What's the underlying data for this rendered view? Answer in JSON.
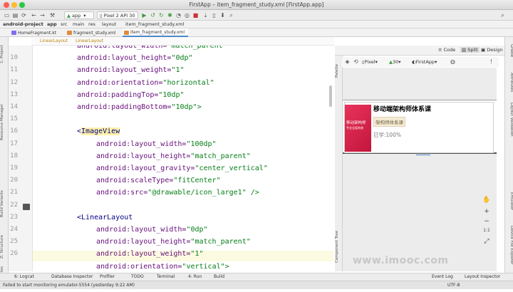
{
  "window": {
    "title": "FirstApp – item_fragment_study.xml [FirstApp.app]"
  },
  "toolbar": {
    "module": "app",
    "device": "Pixel 2 API 30"
  },
  "navbar": {
    "crumbs": [
      "android-project",
      "app",
      "src",
      "main",
      "res",
      "layout",
      "item_fragment_study.xml"
    ]
  },
  "tabs": [
    {
      "label": "HomeFragment.kt",
      "color": "#7f6df2"
    },
    {
      "label": "fragment_study.xml",
      "color": "#e08a3c"
    },
    {
      "label": "item_fragment_study.xml",
      "color": "#e08a3c",
      "active": true
    }
  ],
  "xml_crumbs": [
    "LinearLayout",
    "LinearLayout"
  ],
  "left_strip": [
    "1: Project",
    "Resource Manager",
    "Build Variants",
    "Z: Structure",
    "2: Favorites"
  ],
  "right_strip": [
    "Gradle",
    "Attributes",
    "Layout Validation",
    "Emulator",
    "Device File Explorer"
  ],
  "editor": {
    "line_numbers": [
      "10",
      "11",
      "12",
      "13",
      "14",
      "15",
      "16",
      "17",
      "18",
      "19",
      "20",
      "21",
      "22",
      "23",
      "24",
      "25",
      "26"
    ],
    "lines": [
      {
        "indent": 0,
        "attr": "android:layout_width=",
        "str": "\"match_parent\""
      },
      {
        "indent": 0,
        "attr": "android:layout_height=",
        "str": "\"0dp\"",
        "line": "10"
      },
      {
        "indent": 0,
        "attr": "android:layout_weight=",
        "str": "\"1\""
      },
      {
        "indent": 0,
        "attr": "android:orientation=",
        "str": "\"horizontal\""
      },
      {
        "indent": 0,
        "attr": "android:paddingTop=",
        "str": "\"10dp\""
      },
      {
        "indent": 0,
        "attr": "android:paddingBottom=",
        "str": "\"10dp\">"
      },
      {
        "indent": 0,
        "attr": "",
        "str": ""
      },
      {
        "indent": 0,
        "tag": "<ImageView"
      },
      {
        "indent": 1,
        "attr": "android:layout_width=",
        "str": "\"100dp\""
      },
      {
        "indent": 1,
        "attr": "android:layout_height=",
        "str": "\"match_parent\""
      },
      {
        "indent": 1,
        "attr": "android:layout_gravity=",
        "str": "\"center_vertical\""
      },
      {
        "indent": 1,
        "attr": "android:scaleType=",
        "str": "\"fitCenter\""
      },
      {
        "indent": 1,
        "attr": "android:src=",
        "str": "\"@drawable/icon_large1\" />"
      },
      {
        "indent": 0,
        "attr": "",
        "str": ""
      },
      {
        "indent": 0,
        "tag": "<LinearLayout"
      },
      {
        "indent": 1,
        "attr": "android:layout_width=",
        "str": "\"0dp\""
      },
      {
        "indent": 1,
        "attr": "android:layout_height=",
        "str": "\"match_parent\""
      },
      {
        "indent": 1,
        "attr": "android:layout_weight=",
        "str": "\"1\"",
        "highlight": true
      },
      {
        "indent": 1,
        "attr": "android:orientation=",
        "str": "\"vertical\">"
      }
    ]
  },
  "design": {
    "modes": [
      "Code",
      "Split",
      "Design"
    ],
    "device": "Pixel",
    "api": "30",
    "theme": "FirstApp",
    "preview_title": "移动端架构师体系课",
    "preview_tag": "架构师体系课",
    "preview_progress": "已学:100%",
    "thumb_line1": "移动架构师",
    "thumb_line2": "专业全面系统",
    "side_labels": [
      "Palette",
      "Component Tree"
    ]
  },
  "bottom_tools": [
    "6: Logcat",
    "Database Inspector",
    "Profiler",
    "TODO",
    "Terminal",
    "4: Run",
    "Build",
    "Event Log",
    "Layout Inspector"
  ],
  "status": {
    "message": "Failed to start monitoring emulator-5554 (yesterday 9:22 AM)",
    "encoding": "UTF-8",
    "watermark": "www.imooc.com"
  }
}
